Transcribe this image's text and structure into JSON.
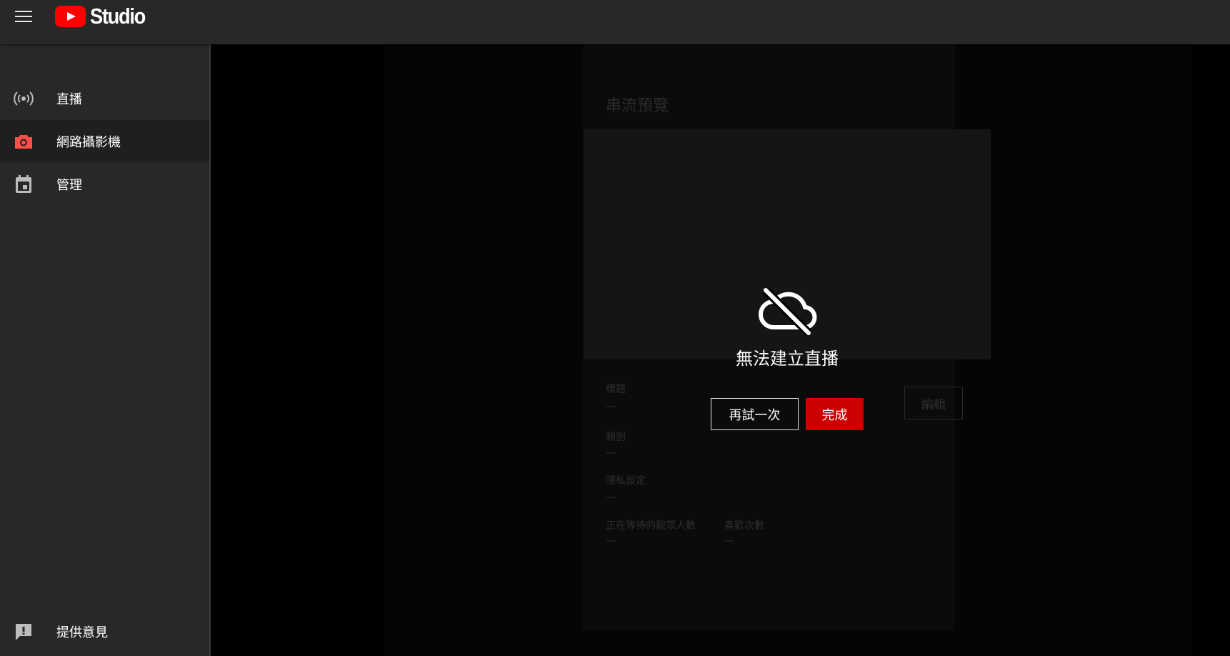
{
  "header": {
    "app_name": "Studio"
  },
  "sidebar": {
    "items": [
      {
        "label": "直播",
        "icon": "live-broadcast-icon"
      },
      {
        "label": "網路攝影機",
        "icon": "camera-icon",
        "active": true,
        "icon_color": "#ff4e45"
      },
      {
        "label": "管理",
        "icon": "calendar-icon"
      }
    ],
    "feedback": {
      "label": "提供意見",
      "icon": "feedback-icon"
    }
  },
  "preview_panel": {
    "title": "串流預覽",
    "fields": {
      "title_label": "標題",
      "title_value": "—",
      "category_label": "類別",
      "category_value": "—",
      "privacy_label": "隱私設定",
      "privacy_value": "—",
      "waiting_label": "正在等待的觀眾人數",
      "waiting_value": "—",
      "likes_label": "喜歡次數",
      "likes_value": "—"
    },
    "edit_label": "編輯"
  },
  "dialog": {
    "icon": "cloud-off-icon",
    "message": "無法建立直播",
    "retry_label": "再試一次",
    "done_label": "完成"
  },
  "colors": {
    "accent": "#cc0000",
    "brand": "#ff0000"
  }
}
